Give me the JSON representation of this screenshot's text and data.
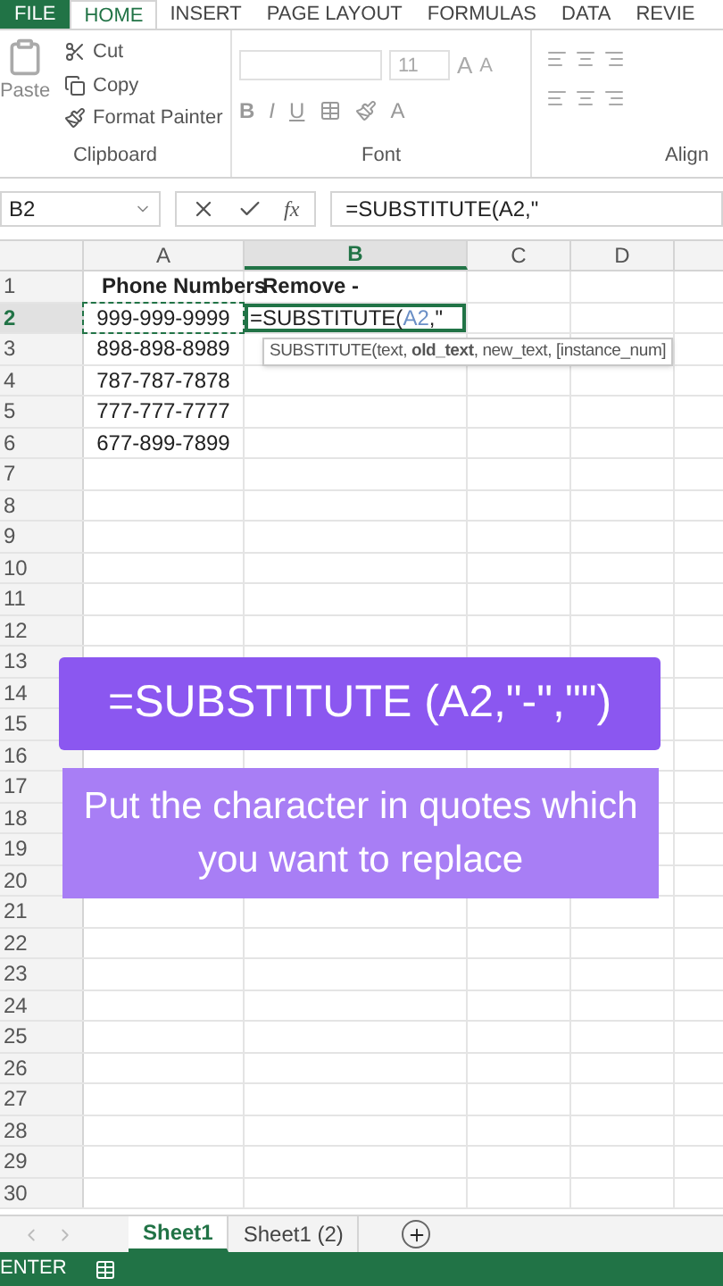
{
  "ribbon_tabs": [
    {
      "label": "FILE",
      "kind": "file",
      "selected": false
    },
    {
      "label": "HOME",
      "kind": "tab",
      "selected": true
    },
    {
      "label": "INSERT",
      "kind": "tab",
      "selected": false
    },
    {
      "label": "PAGE LAYOUT",
      "kind": "tab",
      "selected": false
    },
    {
      "label": "FORMULAS",
      "kind": "tab",
      "selected": false
    },
    {
      "label": "DATA",
      "kind": "tab",
      "selected": false
    },
    {
      "label": "REVIE",
      "kind": "tab",
      "selected": false
    }
  ],
  "clipboard": {
    "paste": "Paste",
    "cut": "Cut",
    "copy": "Copy",
    "format_painter": "Format Painter",
    "group": "Clipboard"
  },
  "font": {
    "size": "11",
    "bold": "B",
    "italic": "I",
    "underline": "U",
    "color_letter": "A",
    "grow": "A",
    "shrink": "A",
    "group": "Font"
  },
  "alignment": {
    "group": "Align"
  },
  "formula_bar": {
    "name_box": "B2",
    "fx": "fx",
    "formula": "=SUBSTITUTE(A2,\""
  },
  "columns": [
    {
      "label": "A",
      "selected": false
    },
    {
      "label": "B",
      "selected": true
    },
    {
      "label": "C",
      "selected": false
    },
    {
      "label": "D",
      "selected": false
    }
  ],
  "rows": [
    {
      "number": "1",
      "selected": false,
      "cells": [
        "Phone Numbers",
        "Remove -"
      ]
    },
    {
      "number": "2",
      "selected": true,
      "cells": [
        "999-999-9999",
        ""
      ]
    },
    {
      "number": "3",
      "selected": false,
      "cells": [
        "898-898-8989"
      ]
    },
    {
      "number": "4",
      "selected": false,
      "cells": [
        "787-787-7878"
      ]
    },
    {
      "number": "5",
      "selected": false,
      "cells": [
        "777-777-7777"
      ]
    },
    {
      "number": "6",
      "selected": false,
      "cells": [
        "677-899-7899"
      ]
    },
    {
      "number": "7",
      "selected": false,
      "cells": []
    },
    {
      "number": "8",
      "selected": false,
      "cells": []
    },
    {
      "number": "9",
      "selected": false,
      "cells": []
    },
    {
      "number": "10",
      "selected": false,
      "cells": []
    },
    {
      "number": "11",
      "selected": false,
      "cells": []
    },
    {
      "number": "12",
      "selected": false,
      "cells": []
    },
    {
      "number": "13",
      "selected": false,
      "cells": []
    },
    {
      "number": "14",
      "selected": false,
      "cells": []
    },
    {
      "number": "15",
      "selected": false,
      "cells": []
    },
    {
      "number": "16",
      "selected": false,
      "cells": []
    },
    {
      "number": "17",
      "selected": false,
      "cells": []
    },
    {
      "number": "18",
      "selected": false,
      "cells": []
    },
    {
      "number": "19",
      "selected": false,
      "cells": []
    },
    {
      "number": "20",
      "selected": false,
      "cells": []
    },
    {
      "number": "21",
      "selected": false,
      "cells": []
    },
    {
      "number": "22",
      "selected": false,
      "cells": []
    },
    {
      "number": "23",
      "selected": false,
      "cells": []
    },
    {
      "number": "24",
      "selected": false,
      "cells": []
    },
    {
      "number": "25",
      "selected": false,
      "cells": []
    },
    {
      "number": "26",
      "selected": false,
      "cells": []
    },
    {
      "number": "27",
      "selected": false,
      "cells": []
    },
    {
      "number": "28",
      "selected": false,
      "cells": []
    },
    {
      "number": "29",
      "selected": false,
      "cells": []
    },
    {
      "number": "30",
      "selected": false,
      "cells": []
    }
  ],
  "edit_cell": {
    "prefix": "=SUBSTITUTE(",
    "ref": "A2",
    "suffix": ",\""
  },
  "tooltip": "SUBSTITUTE(text, **old_text**, new_text, [instance_num]",
  "captions": [
    {
      "text": "=SUBSTITUTE (A2,\"-\",\"\")",
      "kind": "formula"
    },
    {
      "text": "Put the character in quotes which you want to replace",
      "kind": "note"
    }
  ],
  "sheet_tabs": [
    {
      "label": "Sheet1",
      "selected": true
    },
    {
      "label": "Sheet1 (2)",
      "selected": false
    }
  ],
  "status_bar": {
    "mode": "ENTER"
  }
}
